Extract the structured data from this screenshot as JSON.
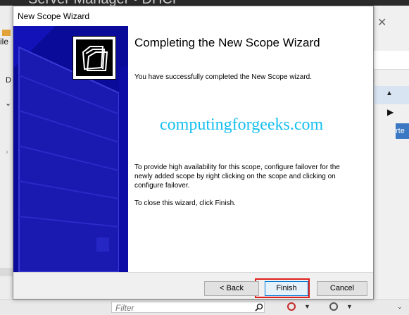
{
  "background": {
    "title": "Server Manager • DHCP",
    "left_menu_label": "ile",
    "left_tree_label": "D",
    "right_button_label": "rte",
    "filter_placeholder": "Filter",
    "icons": [
      "close-icon",
      "scroll-up-arrow-icon",
      "expand-arrow-icon",
      "search-icon",
      "filter-icon",
      "save-icon"
    ]
  },
  "wizard": {
    "title": "New Scope Wizard",
    "heading": "Completing the New Scope Wizard",
    "success_text": "You have successfully completed the New Scope wizard.",
    "watermark": "computingforgeeks.com",
    "failover_text": "To provide high availability for this scope, configure failover for the newly added scope by right clicking on the scope and clicking on configure failover.",
    "close_text": "To close this wizard, click Finish.",
    "buttons": {
      "back": "< Back",
      "finish": "Finish",
      "cancel": "Cancel"
    },
    "colors": {
      "banner": "#0b0b99",
      "watermark": "#16bff0",
      "highlight": "#e0201b"
    }
  }
}
